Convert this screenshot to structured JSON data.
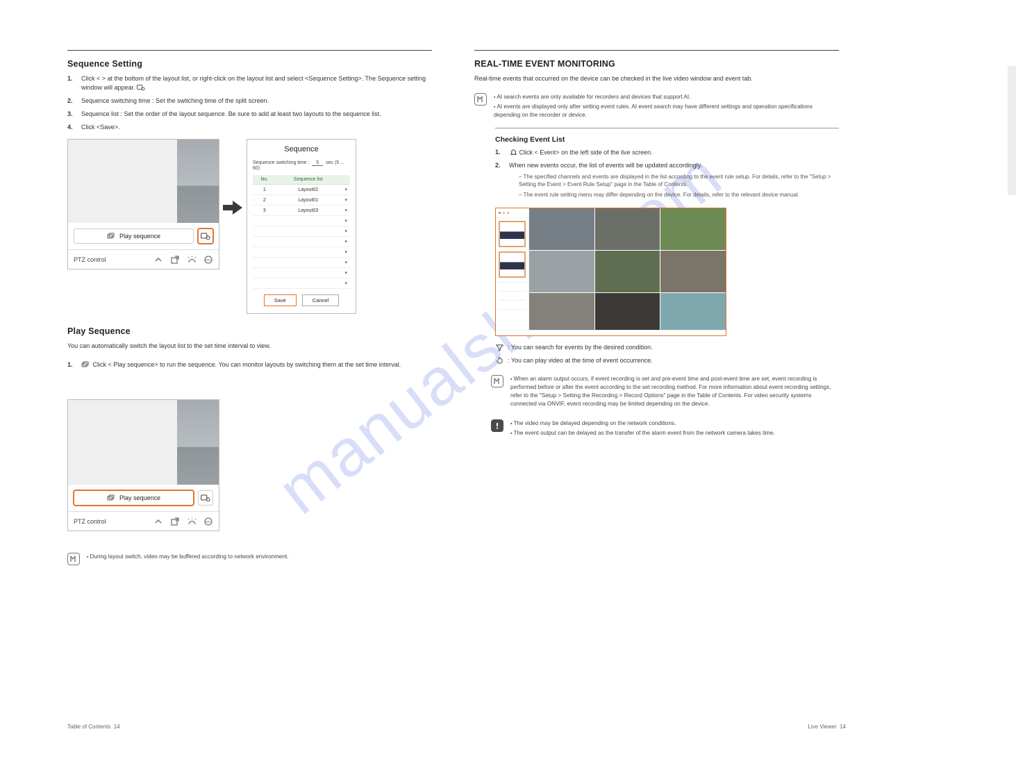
{
  "left": {
    "h_seq_setting": "Sequence Setting",
    "seq_setting_steps": [
      "Click <  > at the bottom of the layout list, or right-click on the layout list and select <Sequence Setting>. The Sequence setting window will appear.",
      "Sequence switching time : Set the switching time of the split screen.",
      "Sequence list : Set the order of the layout sequence. Be sure to add at least two layouts to the sequence list.",
      "Click <Save>."
    ],
    "panel": {
      "play_label": "Play sequence",
      "ptz_label": "PTZ control"
    },
    "dialog": {
      "title": "Sequence",
      "line_prefix": "Sequence switching time :",
      "line_value": "5",
      "line_suffix": "sec  (5 ... 60)",
      "th_no": "No.",
      "th_list": "Sequence list",
      "rows": [
        {
          "no": "1",
          "name": "Layout02"
        },
        {
          "no": "2",
          "name": "Layout01"
        },
        {
          "no": "3",
          "name": "Layout03"
        }
      ],
      "save": "Save",
      "cancel": "Cancel"
    },
    "h_play_seq": "Play Sequence",
    "play_lead": "You can automatically switch the layout list to the set time interval to view.",
    "play_step": "Click <       Play sequence> to run the sequence. You can monitor layouts by switching them at the set time interval.",
    "note": "During layout switch, video may be buffered according to network environment."
  },
  "right": {
    "h_event": "REAL-TIME EVENT MONITORING",
    "lead": "Real-time events that occurred on the device can be checked in the live video window and event tab.",
    "pr_note1": "AI search events are only available for recorders and devices that support AI.",
    "pr_note2": "AI events are displayed only after setting event rules. AI event search may have different settings and operation specifications depending on the recorder or device.",
    "ev_h": "Checking Event List",
    "ev_steps": [
      "Click <      Event> on the left side of the live screen.",
      "When new events occur, the list of events will be updated accordingly."
    ],
    "ev_sub": "The specified channels and events are displayed in the list according to the event rule setup. For details, refer to the \"Setup > Setting the Event > Event Rule Setup\" page in the Table of Contents.",
    "ev_dash": "The event rule setting menu may differ depending on the device. For details, refer to the relevant device manual.",
    "bullets": [
      ": You can search for events by the desired condition.",
      ": You can play video at the time of event occurrence."
    ],
    "m_note1": "When an alarm output occurs, if event recording is set and pre-event time and post-event time are set, event recording is performed before or after the event according to the set recording method. For more information about event recording settings, refer to the \"Setup > Setting the Recording > Record Options\" page in the Table of Contents. For video security systems connected via ONVIF, event recording may be limited depending on the device.",
    "i_note1": "The video may be delayed depending on the network conditions.",
    "i_note2": "The event output can be delayed as the transfer of the alarm event from the network camera takes time."
  },
  "footer": {
    "left_prefix": "Table of Contents",
    "left_page": "14",
    "right_label": "Live Viewer",
    "right_page": "14"
  },
  "watermark": "manualshive.com"
}
